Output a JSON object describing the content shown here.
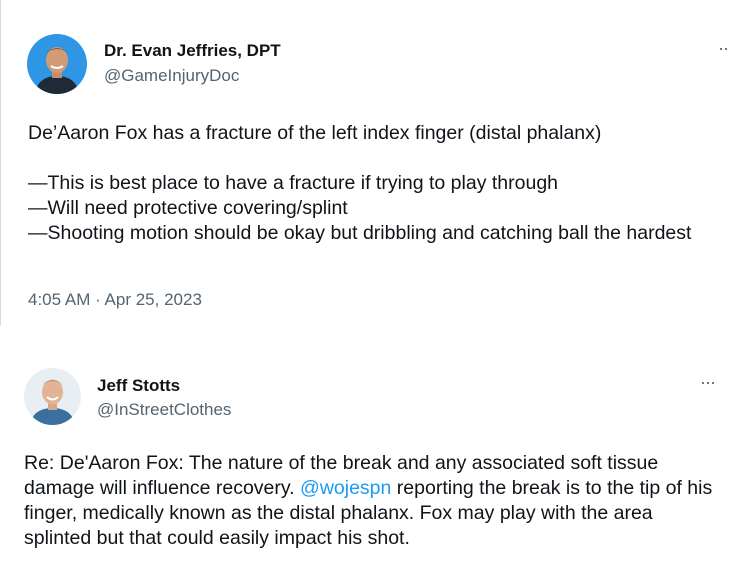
{
  "tweet1": {
    "name": "Dr. Evan Jeffries, DPT",
    "handle": "@GameInjuryDoc",
    "more_icon": "more-dots-icon",
    "text": "De’Aaron Fox has a fracture of the left index finger (distal phalanx)\n\n—This is best place to have a fracture if trying to play through\n—Will need protective covering/splint\n—Shooting motion should be okay but dribbling and catching ball the hardest",
    "timestamp": "4:05 AM · Apr 25, 2023",
    "avatar_bg": "#2f96e6"
  },
  "tweet2": {
    "name": "Jeff Stotts",
    "handle": "@InStreetClothes",
    "more_icon": "more-dots-icon",
    "text_before": "Re: De'Aaron Fox: The nature of the break and any associated soft tissue damage will influence recovery. ",
    "mention": "@wojespn",
    "text_after": " reporting the break is to the tip of his finger, medically known as the distal phalanx. Fox may play with the area splinted but that could easily impact his shot.",
    "avatar_bg": "#e9eef2",
    "mention_color": "#1d9bf0"
  }
}
